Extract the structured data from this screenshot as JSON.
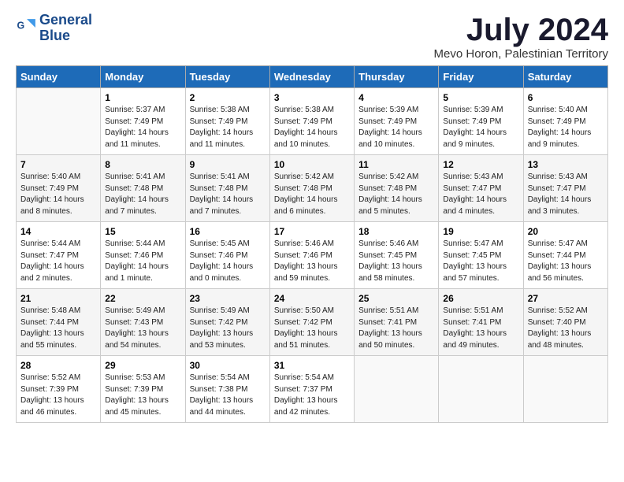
{
  "header": {
    "logo_line1": "General",
    "logo_line2": "Blue",
    "title": "July 2024",
    "subtitle": "Mevo Horon, Palestinian Territory"
  },
  "weekdays": [
    "Sunday",
    "Monday",
    "Tuesday",
    "Wednesday",
    "Thursday",
    "Friday",
    "Saturday"
  ],
  "weeks": [
    [
      {
        "day": "",
        "info": ""
      },
      {
        "day": "1",
        "info": "Sunrise: 5:37 AM\nSunset: 7:49 PM\nDaylight: 14 hours\nand 11 minutes."
      },
      {
        "day": "2",
        "info": "Sunrise: 5:38 AM\nSunset: 7:49 PM\nDaylight: 14 hours\nand 11 minutes."
      },
      {
        "day": "3",
        "info": "Sunrise: 5:38 AM\nSunset: 7:49 PM\nDaylight: 14 hours\nand 10 minutes."
      },
      {
        "day": "4",
        "info": "Sunrise: 5:39 AM\nSunset: 7:49 PM\nDaylight: 14 hours\nand 10 minutes."
      },
      {
        "day": "5",
        "info": "Sunrise: 5:39 AM\nSunset: 7:49 PM\nDaylight: 14 hours\nand 9 minutes."
      },
      {
        "day": "6",
        "info": "Sunrise: 5:40 AM\nSunset: 7:49 PM\nDaylight: 14 hours\nand 9 minutes."
      }
    ],
    [
      {
        "day": "7",
        "info": "Sunrise: 5:40 AM\nSunset: 7:49 PM\nDaylight: 14 hours\nand 8 minutes."
      },
      {
        "day": "8",
        "info": "Sunrise: 5:41 AM\nSunset: 7:48 PM\nDaylight: 14 hours\nand 7 minutes."
      },
      {
        "day": "9",
        "info": "Sunrise: 5:41 AM\nSunset: 7:48 PM\nDaylight: 14 hours\nand 7 minutes."
      },
      {
        "day": "10",
        "info": "Sunrise: 5:42 AM\nSunset: 7:48 PM\nDaylight: 14 hours\nand 6 minutes."
      },
      {
        "day": "11",
        "info": "Sunrise: 5:42 AM\nSunset: 7:48 PM\nDaylight: 14 hours\nand 5 minutes."
      },
      {
        "day": "12",
        "info": "Sunrise: 5:43 AM\nSunset: 7:47 PM\nDaylight: 14 hours\nand 4 minutes."
      },
      {
        "day": "13",
        "info": "Sunrise: 5:43 AM\nSunset: 7:47 PM\nDaylight: 14 hours\nand 3 minutes."
      }
    ],
    [
      {
        "day": "14",
        "info": "Sunrise: 5:44 AM\nSunset: 7:47 PM\nDaylight: 14 hours\nand 2 minutes."
      },
      {
        "day": "15",
        "info": "Sunrise: 5:44 AM\nSunset: 7:46 PM\nDaylight: 14 hours\nand 1 minute."
      },
      {
        "day": "16",
        "info": "Sunrise: 5:45 AM\nSunset: 7:46 PM\nDaylight: 14 hours\nand 0 minutes."
      },
      {
        "day": "17",
        "info": "Sunrise: 5:46 AM\nSunset: 7:46 PM\nDaylight: 13 hours\nand 59 minutes."
      },
      {
        "day": "18",
        "info": "Sunrise: 5:46 AM\nSunset: 7:45 PM\nDaylight: 13 hours\nand 58 minutes."
      },
      {
        "day": "19",
        "info": "Sunrise: 5:47 AM\nSunset: 7:45 PM\nDaylight: 13 hours\nand 57 minutes."
      },
      {
        "day": "20",
        "info": "Sunrise: 5:47 AM\nSunset: 7:44 PM\nDaylight: 13 hours\nand 56 minutes."
      }
    ],
    [
      {
        "day": "21",
        "info": "Sunrise: 5:48 AM\nSunset: 7:44 PM\nDaylight: 13 hours\nand 55 minutes."
      },
      {
        "day": "22",
        "info": "Sunrise: 5:49 AM\nSunset: 7:43 PM\nDaylight: 13 hours\nand 54 minutes."
      },
      {
        "day": "23",
        "info": "Sunrise: 5:49 AM\nSunset: 7:42 PM\nDaylight: 13 hours\nand 53 minutes."
      },
      {
        "day": "24",
        "info": "Sunrise: 5:50 AM\nSunset: 7:42 PM\nDaylight: 13 hours\nand 51 minutes."
      },
      {
        "day": "25",
        "info": "Sunrise: 5:51 AM\nSunset: 7:41 PM\nDaylight: 13 hours\nand 50 minutes."
      },
      {
        "day": "26",
        "info": "Sunrise: 5:51 AM\nSunset: 7:41 PM\nDaylight: 13 hours\nand 49 minutes."
      },
      {
        "day": "27",
        "info": "Sunrise: 5:52 AM\nSunset: 7:40 PM\nDaylight: 13 hours\nand 48 minutes."
      }
    ],
    [
      {
        "day": "28",
        "info": "Sunrise: 5:52 AM\nSunset: 7:39 PM\nDaylight: 13 hours\nand 46 minutes."
      },
      {
        "day": "29",
        "info": "Sunrise: 5:53 AM\nSunset: 7:39 PM\nDaylight: 13 hours\nand 45 minutes."
      },
      {
        "day": "30",
        "info": "Sunrise: 5:54 AM\nSunset: 7:38 PM\nDaylight: 13 hours\nand 44 minutes."
      },
      {
        "day": "31",
        "info": "Sunrise: 5:54 AM\nSunset: 7:37 PM\nDaylight: 13 hours\nand 42 minutes."
      },
      {
        "day": "",
        "info": ""
      },
      {
        "day": "",
        "info": ""
      },
      {
        "day": "",
        "info": ""
      }
    ]
  ]
}
